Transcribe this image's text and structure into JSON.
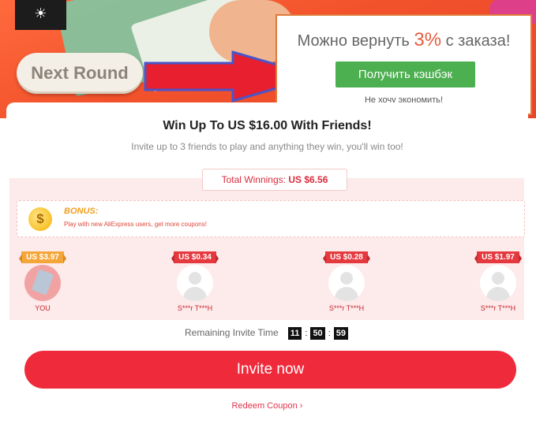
{
  "banner": {
    "settings_icon": "sun-icon",
    "next_round_label": "Next Round"
  },
  "popup": {
    "prefix": "Можно вернуть",
    "percent": "3%",
    "suffix": "с заказа!",
    "cashback_button": "Получить кэшбэк",
    "decline_link": "Не хочу экономить!",
    "border_color": "#e07a3a",
    "button_color": "#4caf50"
  },
  "card": {
    "title": "Win Up To US $16.00 With Friends!",
    "subtitle": "Invite up to 3 friends to play and anything they win, you'll win too!",
    "winnings_label": "Total Winnings:",
    "winnings_value": "US $6.56",
    "bonus": {
      "icon": "coin-icon",
      "coin_symbol": "$",
      "title": "BONUS:",
      "text": "Play with new AliExpress users, get more coupons!"
    },
    "friends": [
      {
        "amount": "US $3.97",
        "name": "YOU"
      },
      {
        "amount": "US $0.34",
        "name": "S***r T***H"
      },
      {
        "amount": "US $0.28",
        "name": "S***r T***H"
      },
      {
        "amount": "US $1.97",
        "name": "S***r T***H"
      }
    ],
    "remaining_label": "Remaining Invite Time",
    "timer": {
      "h": "11",
      "m": "50",
      "s": "59"
    },
    "invite_button": "Invite now",
    "redeem_link": "Redeem Coupon",
    "accent_color": "#ef2a3b"
  }
}
